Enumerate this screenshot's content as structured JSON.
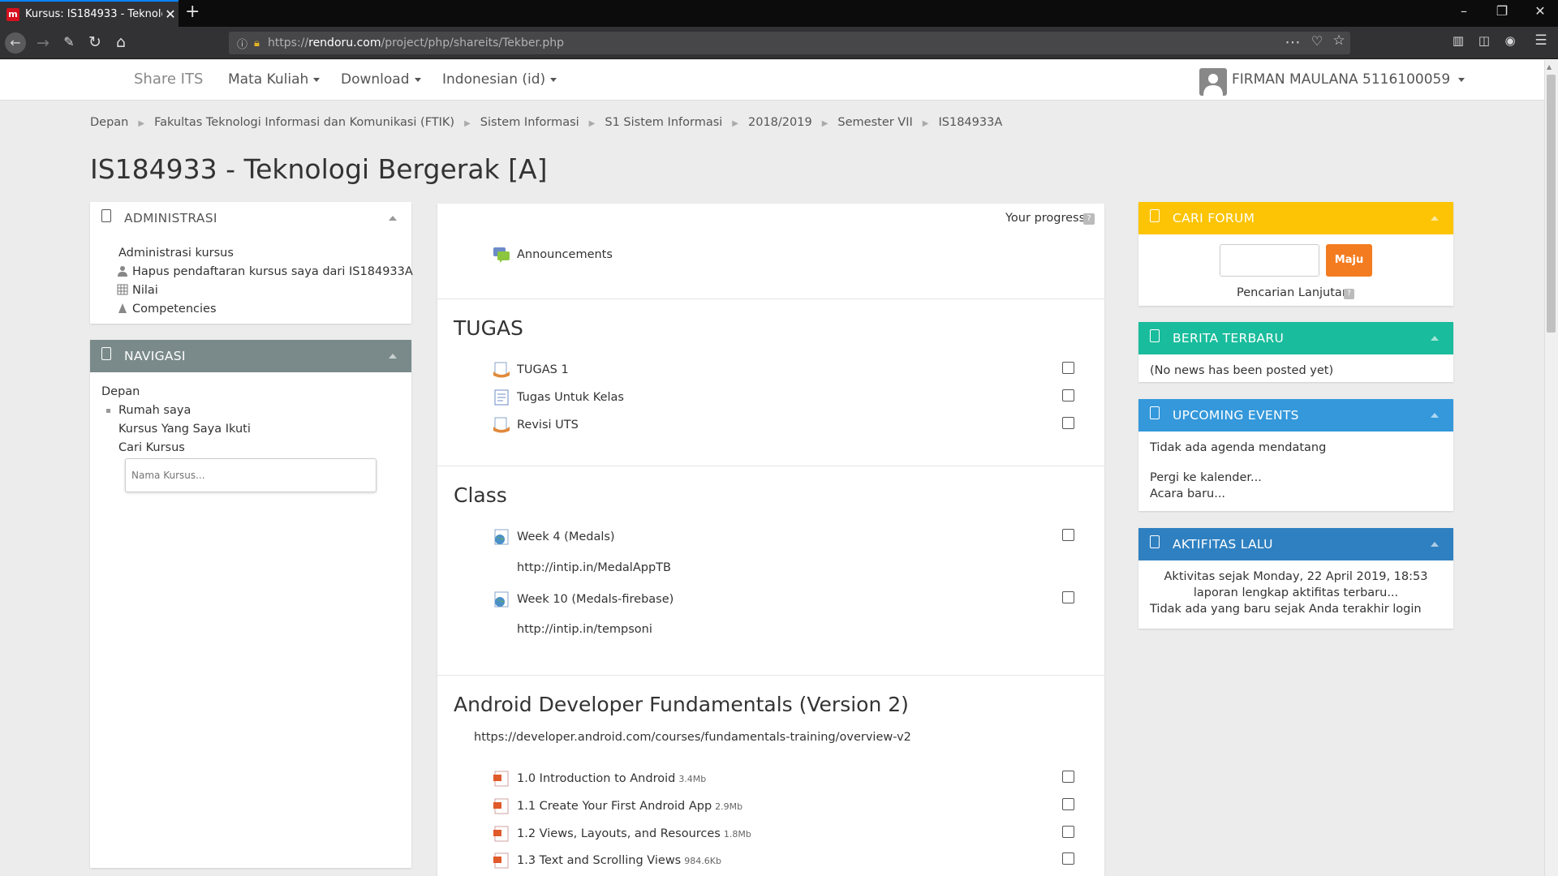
{
  "browser": {
    "tab_title": "Kursus: IS184933 - Teknologi Bergerak [A]",
    "tab_favicon": "m",
    "url_prefix": "https://",
    "url_host": "rendoru.com",
    "url_path": "/project/php/shareits/Tekber.php"
  },
  "navbar": {
    "brand": "Share ITS",
    "menu1": "Mata Kuliah",
    "menu2": "Download",
    "menu3": "Indonesian (id)",
    "user": "FIRMAN MAULANA 5116100059"
  },
  "breadcrumb": [
    "Depan",
    "Fakultas Teknologi Informasi dan Komunikasi (FTIK)",
    "Sistem Informasi",
    "S1 Sistem Informasi",
    "2018/2019",
    "Semester VII",
    "IS184933A"
  ],
  "page_title": "IS184933 - Teknologi Bergerak [A]",
  "admin_block": {
    "title": "ADMINISTRASI",
    "items": [
      "Administrasi kursus",
      "Hapus pendaftaran kursus saya dari IS184933A",
      "Nilai",
      "Competencies"
    ]
  },
  "nav_block": {
    "title": "NAVIGASI",
    "items": [
      "Depan",
      "Rumah saya",
      "Kursus Yang Saya Ikuti",
      "Cari Kursus"
    ],
    "search_placeholder": "Nama Kursus..."
  },
  "content": {
    "progress_label": "Your progress",
    "announcements": "Announcements",
    "sections": [
      {
        "title": "TUGAS",
        "items": [
          "TUGAS 1",
          "Tugas Untuk Kelas",
          "Revisi UTS"
        ]
      },
      {
        "title": "Class",
        "items": [
          "Week 4 (Medals)",
          "http://intip.in/MedalAppTB",
          "Week 10 (Medals-firebase)",
          "http://intip.in/tempsoni"
        ]
      },
      {
        "title": "Android Developer Fundamentals (Version 2)",
        "link": "https://developer.android.com/courses/fundamentals-training/overview-v2",
        "items": [
          {
            "name": "1.0 Introduction to Android",
            "size": "3.4Mb"
          },
          {
            "name": "1.1 Create Your First Android App",
            "size": "2.9Mb"
          },
          {
            "name": "1.2 Views, Layouts, and Resources",
            "size": "1.8Mb"
          },
          {
            "name": "1.3 Text and Scrolling Views",
            "size": "984.6Kb"
          }
        ]
      }
    ]
  },
  "cari_forum": {
    "title": "CARI FORUM",
    "button": "Maju",
    "advanced": "Pencarian Lanjutan",
    "color": "#fcc404"
  },
  "berita": {
    "title": "BERITA TERBARU",
    "body": "(No news has been posted yet)",
    "color": "#19bc9c"
  },
  "events": {
    "title": "UPCOMING EVENTS",
    "body": "Tidak ada agenda mendatang",
    "link1": "Pergi ke kalender...",
    "link2": "Acara baru...",
    "color": "#3498db"
  },
  "aktifitas": {
    "title": "AKTIFITAS LALU",
    "line1": "Aktivitas sejak Monday, 22 April 2019, 18:53",
    "line2": "laporan lengkap aktifitas terbaru...",
    "line3": "Tidak ada yang baru sejak Anda terakhir login",
    "color": "#2f80c0"
  }
}
